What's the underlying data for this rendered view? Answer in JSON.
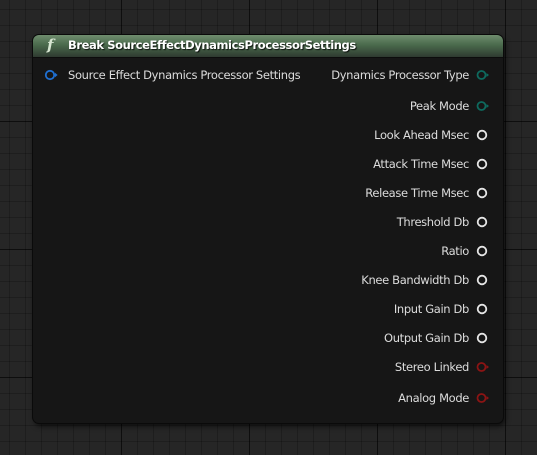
{
  "node": {
    "title": "Break SourceEffectDynamicsProcessorSettings",
    "icon": "function-icon",
    "icon_glyph": "f",
    "header_color": "#4a6a4c",
    "input_pin": {
      "label": "Source Effect Dynamics Processor Settings",
      "type": "struct",
      "color": "#1f6fd1"
    },
    "output_pins": [
      {
        "label": "Dynamics Processor Type",
        "type": "enum",
        "color": "#0e6a5e"
      },
      {
        "label": "Peak Mode",
        "type": "enum",
        "color": "#0e6a5e"
      },
      {
        "label": "Look Ahead Msec",
        "type": "float",
        "color": "#e6e6e6"
      },
      {
        "label": "Attack Time Msec",
        "type": "float",
        "color": "#e6e6e6"
      },
      {
        "label": "Release Time Msec",
        "type": "float",
        "color": "#e6e6e6"
      },
      {
        "label": "Threshold Db",
        "type": "float",
        "color": "#e6e6e6"
      },
      {
        "label": "Ratio",
        "type": "float",
        "color": "#e6e6e6"
      },
      {
        "label": "Knee Bandwidth Db",
        "type": "float",
        "color": "#e6e6e6"
      },
      {
        "label": "Input Gain Db",
        "type": "float",
        "color": "#e6e6e6"
      },
      {
        "label": "Output Gain Db",
        "type": "float",
        "color": "#e6e6e6"
      },
      {
        "label": "Stereo Linked",
        "type": "bool",
        "color": "#8c1414"
      },
      {
        "label": "Analog Mode",
        "type": "bool",
        "color": "#8c1414"
      }
    ]
  }
}
